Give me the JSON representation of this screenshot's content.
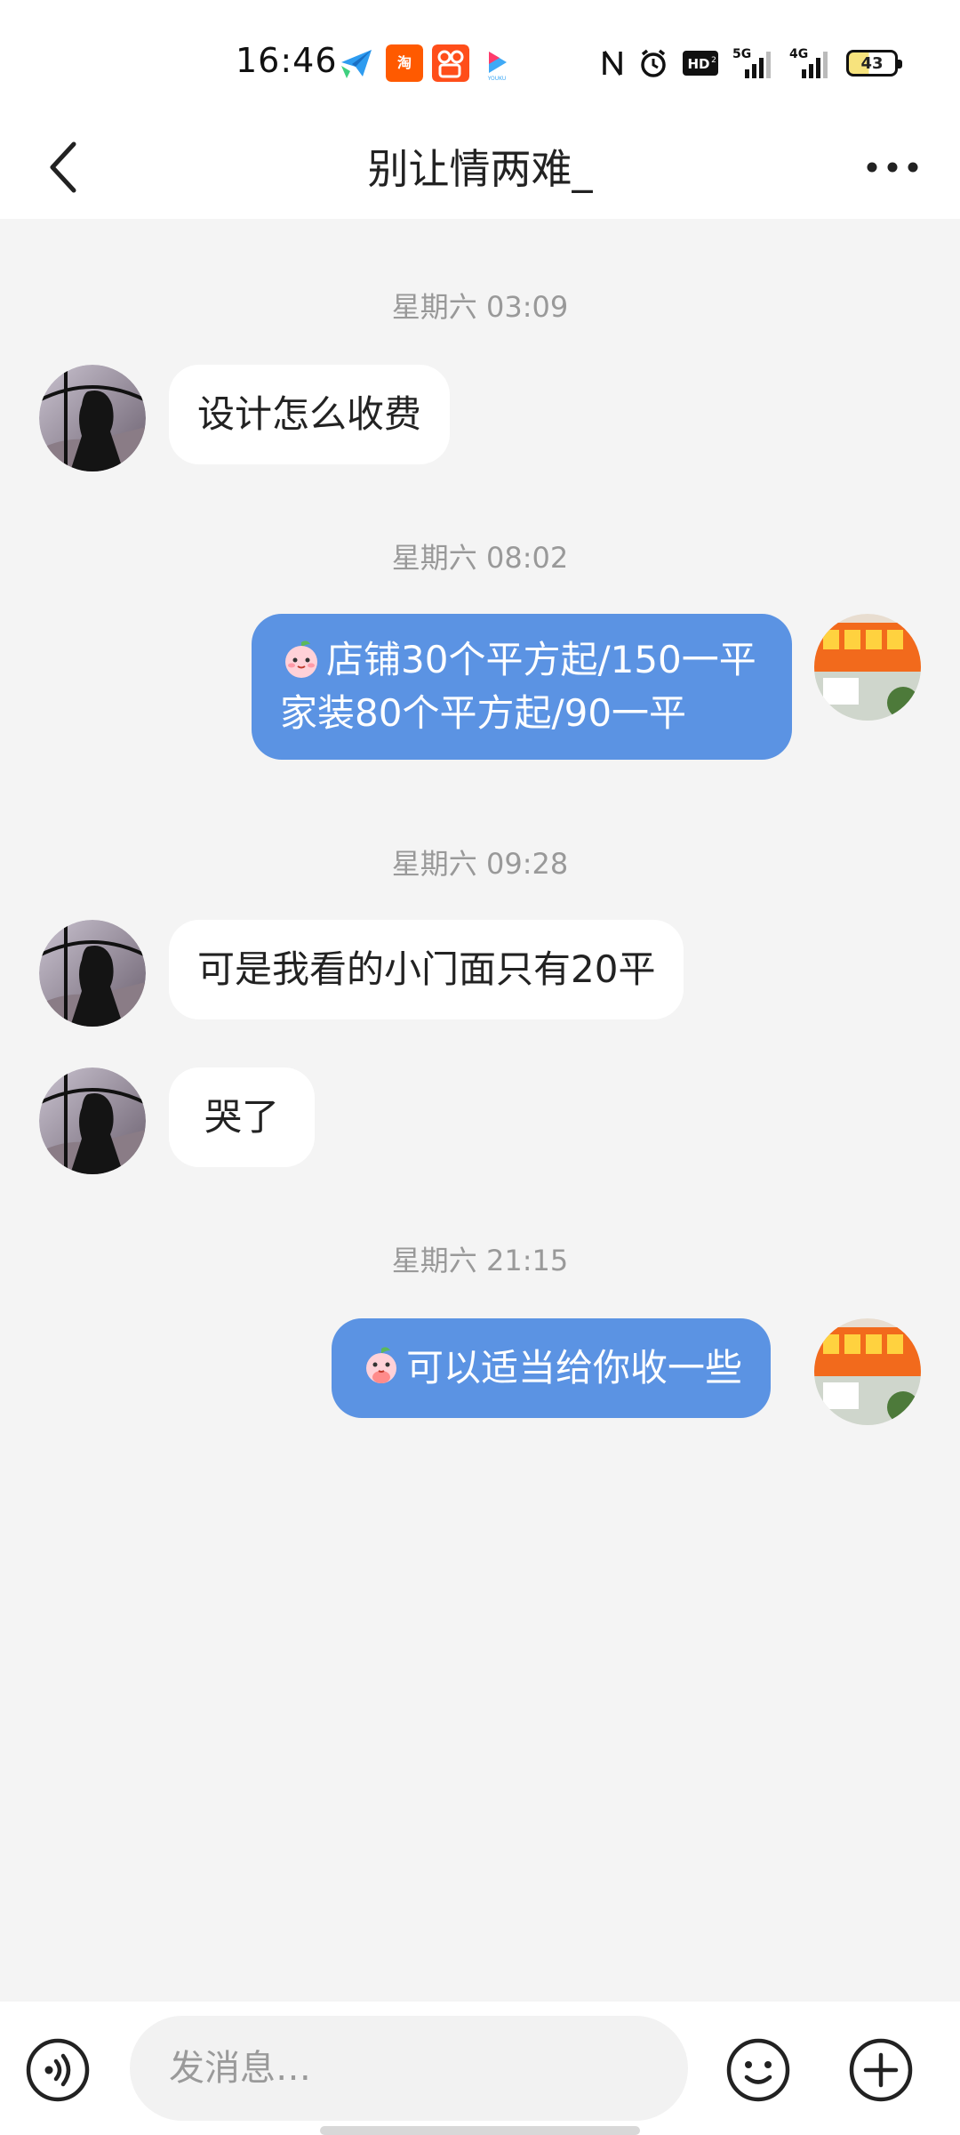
{
  "status_bar": {
    "time": "16:46",
    "app_icons": [
      "paper-plane-icon",
      "taobao-icon",
      "kuaishou-icon",
      "youku-icon"
    ],
    "indicators": [
      "nfc-icon",
      "alarm-icon",
      "hd-icon",
      "5g-signal-icon",
      "4g-signal-icon"
    ],
    "battery_level": "43",
    "battery_color": "#f7e37d"
  },
  "header": {
    "title": "别让情两难_",
    "back_icon": "chevron-left-icon",
    "more_icon": "more-dots-icon"
  },
  "messages": [
    {
      "type": "timestamp",
      "text": "星期六 03:09"
    },
    {
      "type": "incoming",
      "text": "设计怎么收费"
    },
    {
      "type": "timestamp",
      "text": "星期六 08:02"
    },
    {
      "type": "outgoing",
      "line1": "店铺30个平方起/150一平",
      "line2": "家装80个平方起/90一平"
    },
    {
      "type": "timestamp",
      "text": "星期六 09:28"
    },
    {
      "type": "incoming",
      "text": "可是我看的小门面只有20平"
    },
    {
      "type": "incoming",
      "text": "哭了"
    },
    {
      "type": "timestamp",
      "text": "星期六 21:15"
    },
    {
      "type": "outgoing",
      "text": "可以适当给你收一些"
    }
  ],
  "input_bar": {
    "placeholder": "发消息…",
    "voice_icon": "voice-icon",
    "emoji_icon": "smiley-icon",
    "plus_icon": "plus-circle-icon"
  },
  "colors": {
    "outgoing_bubble": "#5b93e3",
    "incoming_bubble": "#ffffff",
    "background": "#f4f4f4"
  }
}
